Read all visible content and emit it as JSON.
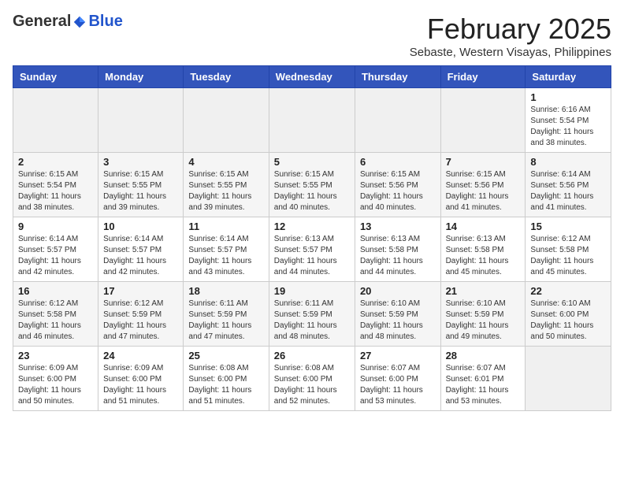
{
  "header": {
    "logo": {
      "general": "General",
      "blue": "Blue"
    },
    "title": "February 2025",
    "location": "Sebaste, Western Visayas, Philippines"
  },
  "weekdays": [
    "Sunday",
    "Monday",
    "Tuesday",
    "Wednesday",
    "Thursday",
    "Friday",
    "Saturday"
  ],
  "weeks": [
    [
      {
        "day": "",
        "empty": true
      },
      {
        "day": "",
        "empty": true
      },
      {
        "day": "",
        "empty": true
      },
      {
        "day": "",
        "empty": true
      },
      {
        "day": "",
        "empty": true
      },
      {
        "day": "",
        "empty": true
      },
      {
        "day": "1",
        "sunrise": "6:16 AM",
        "sunset": "5:54 PM",
        "daylight": "11 hours and 38 minutes."
      }
    ],
    [
      {
        "day": "2",
        "sunrise": "6:15 AM",
        "sunset": "5:54 PM",
        "daylight": "11 hours and 38 minutes."
      },
      {
        "day": "3",
        "sunrise": "6:15 AM",
        "sunset": "5:55 PM",
        "daylight": "11 hours and 39 minutes."
      },
      {
        "day": "4",
        "sunrise": "6:15 AM",
        "sunset": "5:55 PM",
        "daylight": "11 hours and 39 minutes."
      },
      {
        "day": "5",
        "sunrise": "6:15 AM",
        "sunset": "5:55 PM",
        "daylight": "11 hours and 40 minutes."
      },
      {
        "day": "6",
        "sunrise": "6:15 AM",
        "sunset": "5:56 PM",
        "daylight": "11 hours and 40 minutes."
      },
      {
        "day": "7",
        "sunrise": "6:15 AM",
        "sunset": "5:56 PM",
        "daylight": "11 hours and 41 minutes."
      },
      {
        "day": "8",
        "sunrise": "6:14 AM",
        "sunset": "5:56 PM",
        "daylight": "11 hours and 41 minutes."
      }
    ],
    [
      {
        "day": "9",
        "sunrise": "6:14 AM",
        "sunset": "5:57 PM",
        "daylight": "11 hours and 42 minutes."
      },
      {
        "day": "10",
        "sunrise": "6:14 AM",
        "sunset": "5:57 PM",
        "daylight": "11 hours and 42 minutes."
      },
      {
        "day": "11",
        "sunrise": "6:14 AM",
        "sunset": "5:57 PM",
        "daylight": "11 hours and 43 minutes."
      },
      {
        "day": "12",
        "sunrise": "6:13 AM",
        "sunset": "5:57 PM",
        "daylight": "11 hours and 44 minutes."
      },
      {
        "day": "13",
        "sunrise": "6:13 AM",
        "sunset": "5:58 PM",
        "daylight": "11 hours and 44 minutes."
      },
      {
        "day": "14",
        "sunrise": "6:13 AM",
        "sunset": "5:58 PM",
        "daylight": "11 hours and 45 minutes."
      },
      {
        "day": "15",
        "sunrise": "6:12 AM",
        "sunset": "5:58 PM",
        "daylight": "11 hours and 45 minutes."
      }
    ],
    [
      {
        "day": "16",
        "sunrise": "6:12 AM",
        "sunset": "5:58 PM",
        "daylight": "11 hours and 46 minutes."
      },
      {
        "day": "17",
        "sunrise": "6:12 AM",
        "sunset": "5:59 PM",
        "daylight": "11 hours and 47 minutes."
      },
      {
        "day": "18",
        "sunrise": "6:11 AM",
        "sunset": "5:59 PM",
        "daylight": "11 hours and 47 minutes."
      },
      {
        "day": "19",
        "sunrise": "6:11 AM",
        "sunset": "5:59 PM",
        "daylight": "11 hours and 48 minutes."
      },
      {
        "day": "20",
        "sunrise": "6:10 AM",
        "sunset": "5:59 PM",
        "daylight": "11 hours and 48 minutes."
      },
      {
        "day": "21",
        "sunrise": "6:10 AM",
        "sunset": "5:59 PM",
        "daylight": "11 hours and 49 minutes."
      },
      {
        "day": "22",
        "sunrise": "6:10 AM",
        "sunset": "6:00 PM",
        "daylight": "11 hours and 50 minutes."
      }
    ],
    [
      {
        "day": "23",
        "sunrise": "6:09 AM",
        "sunset": "6:00 PM",
        "daylight": "11 hours and 50 minutes."
      },
      {
        "day": "24",
        "sunrise": "6:09 AM",
        "sunset": "6:00 PM",
        "daylight": "11 hours and 51 minutes."
      },
      {
        "day": "25",
        "sunrise": "6:08 AM",
        "sunset": "6:00 PM",
        "daylight": "11 hours and 51 minutes."
      },
      {
        "day": "26",
        "sunrise": "6:08 AM",
        "sunset": "6:00 PM",
        "daylight": "11 hours and 52 minutes."
      },
      {
        "day": "27",
        "sunrise": "6:07 AM",
        "sunset": "6:00 PM",
        "daylight": "11 hours and 53 minutes."
      },
      {
        "day": "28",
        "sunrise": "6:07 AM",
        "sunset": "6:01 PM",
        "daylight": "11 hours and 53 minutes."
      },
      {
        "day": "",
        "empty": true
      }
    ]
  ]
}
